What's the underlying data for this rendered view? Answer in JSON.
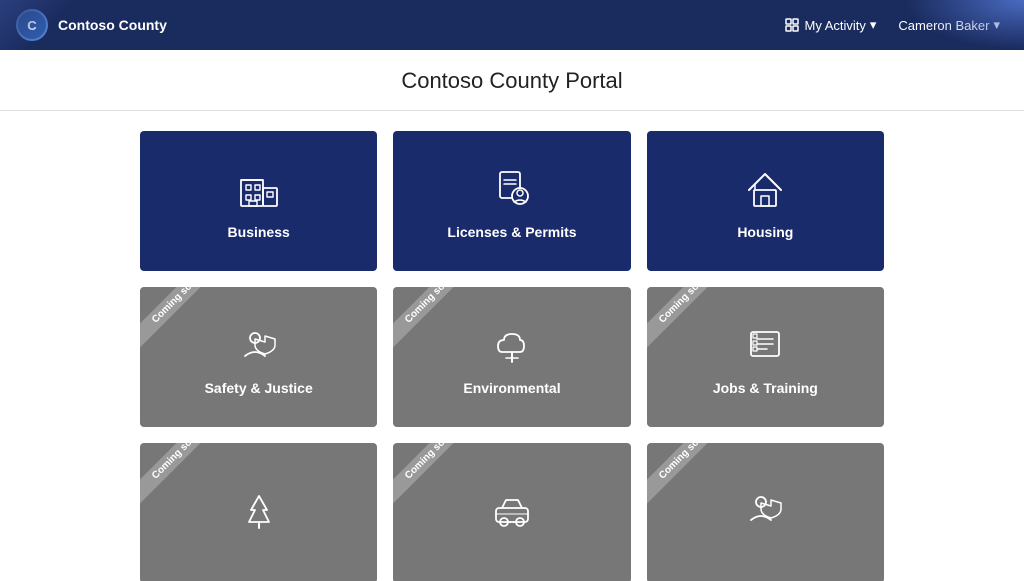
{
  "header": {
    "logo_text": "C",
    "app_name": "Contoso County",
    "activity_label": "My Activity",
    "user_label": "Cameron Baker",
    "chevron": "▾"
  },
  "portal": {
    "title": "Contoso County Portal"
  },
  "tiles": {
    "active": [
      {
        "id": "business",
        "label": "Business",
        "icon": "building"
      },
      {
        "id": "licenses-permits",
        "label": "Licenses & Permits",
        "icon": "permit"
      },
      {
        "id": "housing",
        "label": "Housing",
        "icon": "house"
      }
    ],
    "inactive": [
      {
        "id": "safety-justice",
        "label": "Safety & Justice",
        "icon": "safety"
      },
      {
        "id": "environmental",
        "label": "Environmental",
        "icon": "tree"
      },
      {
        "id": "jobs-training",
        "label": "Jobs & Training",
        "icon": "jobs"
      },
      {
        "id": "parks",
        "label": "",
        "icon": "parks"
      },
      {
        "id": "transportation",
        "label": "",
        "icon": "car"
      },
      {
        "id": "people",
        "label": "",
        "icon": "people2"
      }
    ],
    "coming_soon_label": "Coming soon"
  }
}
